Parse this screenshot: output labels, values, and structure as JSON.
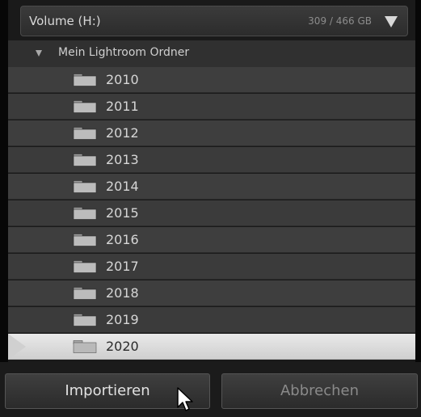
{
  "volume": {
    "name": "Volume (H:)",
    "capacity": "309 / 466 GB"
  },
  "tree": {
    "root_label": "Mein Lightroom Ordner",
    "folders": [
      "2010",
      "2011",
      "2012",
      "2013",
      "2014",
      "2015",
      "2016",
      "2017",
      "2018",
      "2019",
      "2020"
    ],
    "selected": "2020"
  },
  "footer": {
    "import_label": "Importieren",
    "cancel_label": "Abbrechen"
  },
  "colors": {
    "panel_background": "#3e3e3e",
    "selected_row": "#d6d6d6",
    "text_light": "#d6d6d6"
  },
  "icons": [
    "folder-icon",
    "disclosure-triangle-icon",
    "dropdown-arrow-icon",
    "mouse-cursor-icon"
  ]
}
